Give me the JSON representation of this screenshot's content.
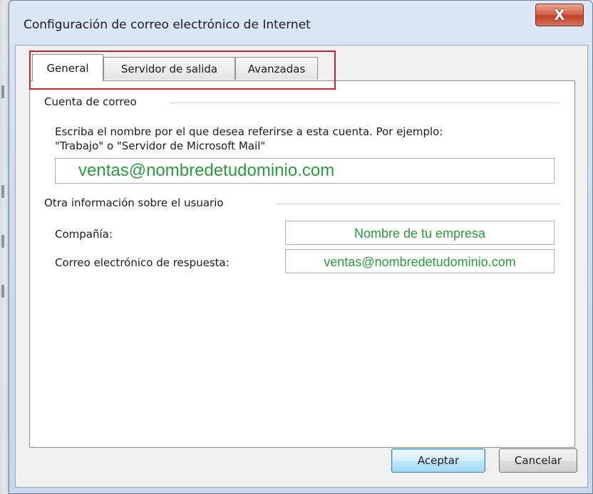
{
  "window": {
    "title": "Configuración de correo electrónico de Internet",
    "close_label": "X"
  },
  "tabs": [
    {
      "label": "General",
      "active": true
    },
    {
      "label": "Servidor de salida",
      "active": false
    },
    {
      "label": "Avanzadas",
      "active": false
    }
  ],
  "account": {
    "group_label": "Cuenta de correo",
    "instruction_line1": "Escriba el nombre por el que desea referirse a esta cuenta. Por ejemplo:",
    "instruction_line2": "\"Trabajo\" o \"Servidor de Microsoft Mail\"",
    "account_name_value": "ventas@nombredetudominio.com"
  },
  "user_info": {
    "group_label": "Otra información sobre el usuario",
    "company_label": "Compañía:",
    "company_value": "Nombre de tu empresa",
    "reply_email_label": "Correo electrónico de respuesta:",
    "reply_email_value": "ventas@nombredetudominio.com"
  },
  "buttons": {
    "ok_label": "Aceptar",
    "cancel_label": "Cancelar"
  },
  "colors": {
    "highlight": "#c0292e",
    "field_text": "#2a9a3e",
    "close_button": "#c2412a"
  }
}
